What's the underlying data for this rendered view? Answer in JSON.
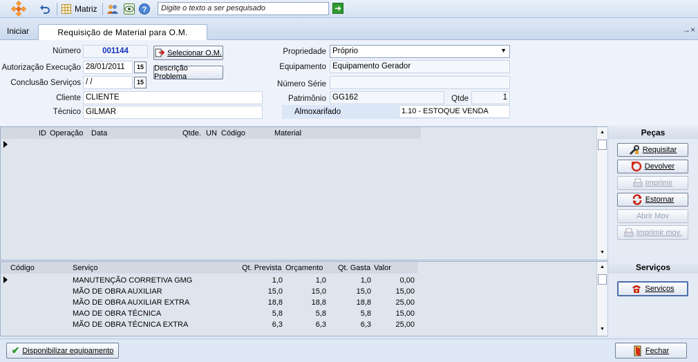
{
  "toolbar": {
    "matriz_label": "Matriz",
    "search_placeholder": "Digite o texto a ser pesquisado"
  },
  "tabs": {
    "iniciar": "Iniciar",
    "active": "Requisição de Material para O.M.",
    "pin_close": "→×"
  },
  "form": {
    "numero_label": "Número",
    "numero_value": "001144",
    "autorizacao_label": "Autorização Execução",
    "autorizacao_value": "28/01/2011",
    "conclusao_label": "Conclusão Serviços",
    "conclusao_value": " / /",
    "cliente_label": "Cliente",
    "cliente_value": "CLIENTE",
    "tecnico_label": "Técnico",
    "tecnico_value": "GILMAR",
    "selecionar_label": "Selecionar O.M.",
    "descricao_label": "Descrição Problema",
    "propriedade_label": "Propriedade",
    "propriedade_value": "Próprio",
    "equipamento_label": "Equipamento",
    "equipamento_value": "Equipamento Gerador",
    "numero_serie_label": "Número Série",
    "numero_serie_value": "",
    "patrimonio_label": "Patrimônio",
    "patrimonio_value": "GG162",
    "qtde_label": "Qtde",
    "qtde_value": "1",
    "almoxarifado_label": "Almoxarifado",
    "almoxarifado_value": "1.10 - ESTOQUE VENDA",
    "calendar_glyph": "15"
  },
  "pecas_grid": {
    "headers": [
      "ID",
      "Operação",
      "Data",
      "Qtde.",
      "UN",
      "Código",
      "Material"
    ]
  },
  "pecas_panel": {
    "title": "Peças",
    "requisitar": "Requisitar",
    "devolver": "Devolver",
    "imprimir": "Imprimir",
    "estornar": "Estornar",
    "abrir_mov": "Abrir Mov",
    "imprimir_mov": "Imprimir mov."
  },
  "servicos_grid": {
    "headers": [
      "Código",
      "Serviço",
      "Qt. Prevista",
      "Orçamento",
      "Qt. Gasta",
      "Valor"
    ],
    "rows": [
      {
        "codigo": "",
        "servico": "MANUTENÇÃO CORRETIVA GMG",
        "prevista": "1,0",
        "orcamento": "1,0",
        "gasta": "1,0",
        "valor": "0,00"
      },
      {
        "codigo": "",
        "servico": "MÃO DE OBRA AUXILIAR",
        "prevista": "15,0",
        "orcamento": "15,0",
        "gasta": "15,0",
        "valor": "15,00"
      },
      {
        "codigo": "",
        "servico": "MÃO DE OBRA AUXILIAR EXTRA",
        "prevista": "18,8",
        "orcamento": "18,8",
        "gasta": "18,8",
        "valor": "25,00"
      },
      {
        "codigo": "",
        "servico": "MAO DE OBRA TÉCNICA",
        "prevista": "5,8",
        "orcamento": "5,8",
        "gasta": "5,8",
        "valor": "15,00"
      },
      {
        "codigo": "",
        "servico": "MÃO DE OBRA TÉCNICA EXTRA",
        "prevista": "6,3",
        "orcamento": "6,3",
        "gasta": "6,3",
        "valor": "25,00"
      }
    ]
  },
  "servicos_panel": {
    "title": "Serviços",
    "servicos_button": "Serviços"
  },
  "footer": {
    "disponibilizar": "Disponibilizar equipamento",
    "fechar": "Fechar"
  }
}
